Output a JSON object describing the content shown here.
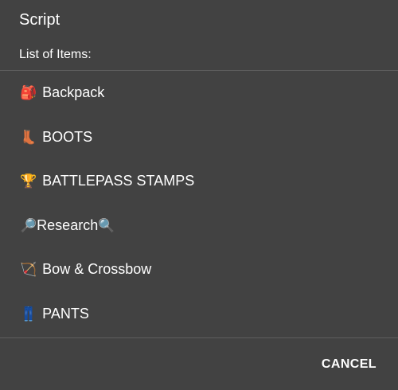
{
  "dialog": {
    "title": "Script",
    "subtitle": "List of Items:",
    "cancel_label": "CANCEL"
  },
  "items": [
    {
      "icon": "backpack-icon",
      "label": "Backpack",
      "glyph": "🎒"
    },
    {
      "icon": "boot-icon",
      "label": "BOOTS",
      "glyph": "👢"
    },
    {
      "icon": "trophy-icon",
      "label": "BATTLEPASS STAMPS",
      "glyph": "🏆"
    },
    {
      "icon": "magnifier-icon",
      "label": "Research",
      "glyph_left": "🔎",
      "glyph_right": "🔍"
    },
    {
      "icon": "bow-and-arrow-icon",
      "label": "Bow & Crossbow",
      "glyph": "🏹"
    },
    {
      "icon": "jeans-icon",
      "label": "PANTS",
      "glyph": "👖"
    }
  ],
  "colors": {
    "background": "#424242",
    "divider": "#5e5e5e",
    "text": "#ffffff"
  }
}
